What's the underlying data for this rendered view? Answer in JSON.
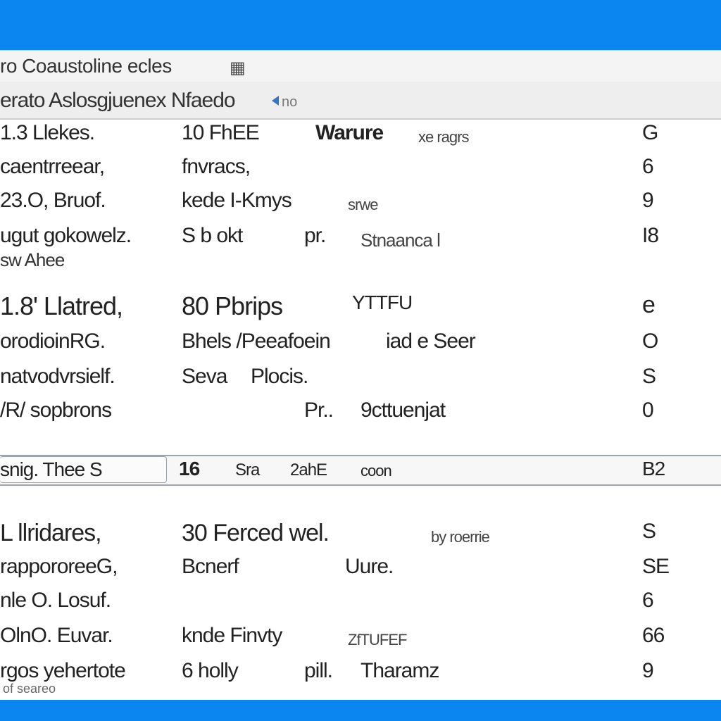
{
  "window": {
    "title": "ro Coaustoline ecles",
    "title_icon": "grid-icon"
  },
  "toolbar": {
    "text": "erato Aslosgjuenex Nfaedo",
    "suffix": "no"
  },
  "rows": [
    {
      "c1": "1.3 Llekes.",
      "c2": "10 FhEE",
      "c3": "Warure",
      "c4": "xe ragrs",
      "num": "G",
      "bold3": true
    },
    {
      "c1": "caentrreear,",
      "c2": "fnvracs,",
      "c3": "",
      "c4": "",
      "num": "6"
    },
    {
      "c1": "23.O, Bruof.",
      "c2": "kede I-Kmys",
      "c3": "",
      "c4": "srwe",
      "num": "9"
    },
    {
      "c1": "ugut gokowelz.",
      "c2": "S b okt",
      "c3": "pr.",
      "c4": "Stnaanca l",
      "num": "I8",
      "sub": "sw Ahee"
    },
    {
      "c1": "1.8' Llatred,",
      "c2": "80 Pbrips",
      "c3": "YTTFU",
      "c4": "",
      "num": "e"
    },
    {
      "c1": "orodioinRG.",
      "c2": "Bhels /Peeafoein",
      "c3": "",
      "c4": "iad e Seer",
      "num": "O"
    },
    {
      "c1": "natvodvrsielf.",
      "c2": "Seva",
      "c3": "Plocis.",
      "c4": "",
      "num": "S"
    },
    {
      "c1": "/R/ sopbrons",
      "c2": "",
      "c3": "Pr..",
      "c4": "9cttuenjat",
      "num": "0"
    }
  ],
  "selected_row": {
    "c1": "snig. Thee S",
    "c2": "16",
    "c3": "Sra",
    "c4": "2ahE",
    "c5": "coon",
    "num": "B2"
  },
  "rows_after": [
    {
      "c1": "L llridares,",
      "c2": "30 Ferced wel.",
      "c3": "",
      "c4": "by roerrie",
      "num": "S"
    },
    {
      "c1": "rappororeeG,",
      "c2": "Bcnerf",
      "c3": "",
      "c4": "Uure.",
      "num": "SE"
    },
    {
      "c1": "nle O. Losuf.",
      "c2": "",
      "c3": "",
      "c4": "",
      "num": "6"
    },
    {
      "c1": "OlnO. Euvar.",
      "c2": "knde Finvty",
      "c3": "",
      "c4": "ZfTUFEF",
      "num": "66"
    },
    {
      "c1": "rgos yehertote",
      "c2": "6 holly",
      "c3": "pill.",
      "c4": "Tharamz",
      "num": "9"
    }
  ],
  "footer_note": "of seareo"
}
